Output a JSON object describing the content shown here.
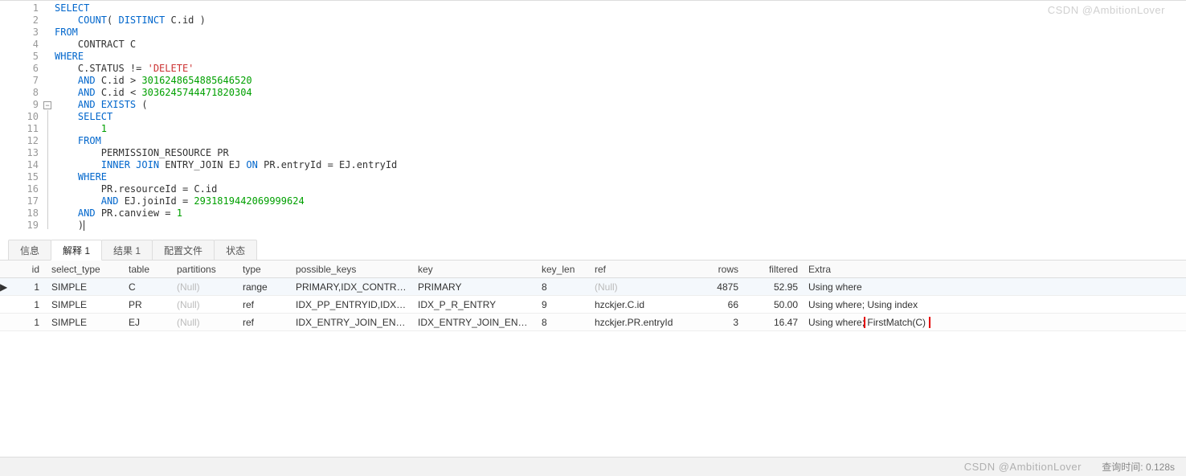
{
  "sql": {
    "lines": [
      {
        "n": 1,
        "tokens": [
          {
            "t": "SELECT",
            "c": "kw"
          }
        ]
      },
      {
        "n": 2,
        "tokens": [
          {
            "t": "    ",
            "c": ""
          },
          {
            "t": "COUNT",
            "c": "kw"
          },
          {
            "t": "( ",
            "c": ""
          },
          {
            "t": "DISTINCT",
            "c": "kw"
          },
          {
            "t": " C.id )",
            "c": ""
          }
        ]
      },
      {
        "n": 3,
        "tokens": [
          {
            "t": "FROM",
            "c": "kw"
          }
        ]
      },
      {
        "n": 4,
        "tokens": [
          {
            "t": "    CONTRACT C",
            "c": ""
          }
        ]
      },
      {
        "n": 5,
        "tokens": [
          {
            "t": "WHERE",
            "c": "kw"
          }
        ]
      },
      {
        "n": 6,
        "tokens": [
          {
            "t": "    C.STATUS != ",
            "c": ""
          },
          {
            "t": "'DELETE'",
            "c": "str"
          }
        ]
      },
      {
        "n": 7,
        "tokens": [
          {
            "t": "    ",
            "c": ""
          },
          {
            "t": "AND",
            "c": "kw"
          },
          {
            "t": " C.id > ",
            "c": ""
          },
          {
            "t": "3016248654885646520",
            "c": "num"
          }
        ]
      },
      {
        "n": 8,
        "tokens": [
          {
            "t": "    ",
            "c": ""
          },
          {
            "t": "AND",
            "c": "kw"
          },
          {
            "t": " C.id < ",
            "c": ""
          },
          {
            "t": "3036245744471820304",
            "c": "num"
          }
        ]
      },
      {
        "n": 9,
        "tokens": [
          {
            "t": "    ",
            "c": ""
          },
          {
            "t": "AND EXISTS",
            "c": "kw"
          },
          {
            "t": " (",
            "c": ""
          }
        ]
      },
      {
        "n": 10,
        "tokens": [
          {
            "t": "    ",
            "c": ""
          },
          {
            "t": "SELECT",
            "c": "kw"
          }
        ]
      },
      {
        "n": 11,
        "tokens": [
          {
            "t": "        ",
            "c": ""
          },
          {
            "t": "1",
            "c": "num"
          }
        ]
      },
      {
        "n": 12,
        "tokens": [
          {
            "t": "    ",
            "c": ""
          },
          {
            "t": "FROM",
            "c": "kw"
          }
        ]
      },
      {
        "n": 13,
        "tokens": [
          {
            "t": "        PERMISSION_RESOURCE PR",
            "c": ""
          }
        ]
      },
      {
        "n": 14,
        "tokens": [
          {
            "t": "        ",
            "c": ""
          },
          {
            "t": "INNER JOIN",
            "c": "kw"
          },
          {
            "t": " ENTRY_JOIN EJ ",
            "c": ""
          },
          {
            "t": "ON",
            "c": "kw"
          },
          {
            "t": " PR.entryId = EJ.entryId",
            "c": ""
          }
        ]
      },
      {
        "n": 15,
        "tokens": [
          {
            "t": "    ",
            "c": ""
          },
          {
            "t": "WHERE",
            "c": "kw"
          }
        ]
      },
      {
        "n": 16,
        "tokens": [
          {
            "t": "        PR.resourceId = C.id",
            "c": ""
          }
        ]
      },
      {
        "n": 17,
        "tokens": [
          {
            "t": "        ",
            "c": ""
          },
          {
            "t": "AND",
            "c": "kw"
          },
          {
            "t": " EJ.joinId = ",
            "c": ""
          },
          {
            "t": "2931819442069999624",
            "c": "num"
          }
        ]
      },
      {
        "n": 18,
        "tokens": [
          {
            "t": "    ",
            "c": ""
          },
          {
            "t": "AND",
            "c": "kw"
          },
          {
            "t": " PR.canview = ",
            "c": ""
          },
          {
            "t": "1",
            "c": "num"
          }
        ]
      },
      {
        "n": 19,
        "tokens": [
          {
            "t": "    )",
            "c": ""
          }
        ],
        "cursor": true
      }
    ]
  },
  "tabs": {
    "items": [
      {
        "label": "信息",
        "active": false
      },
      {
        "label": "解释 1",
        "active": true
      },
      {
        "label": "结果 1",
        "active": false
      },
      {
        "label": "配置文件",
        "active": false
      },
      {
        "label": "状态",
        "active": false
      }
    ]
  },
  "grid": {
    "columns": {
      "id": "id",
      "select_type": "select_type",
      "table": "table",
      "partitions": "partitions",
      "type": "type",
      "possible_keys": "possible_keys",
      "key": "key",
      "key_len": "key_len",
      "ref": "ref",
      "rows": "rows",
      "filtered": "filtered",
      "Extra": "Extra"
    },
    "null_text": "(Null)",
    "rows": [
      {
        "sel": true,
        "id": "1",
        "select_type": "SIMPLE",
        "table": "C",
        "partitions": "(Null)",
        "type": "range",
        "possible_keys": "PRIMARY,IDX_CONTRACT",
        "key": "PRIMARY",
        "key_len": "8",
        "ref": "(Null)",
        "rows": "4875",
        "filtered": "52.95",
        "Extra": "Using where"
      },
      {
        "sel": false,
        "id": "1",
        "select_type": "SIMPLE",
        "table": "PR",
        "partitions": "(Null)",
        "type": "ref",
        "possible_keys": "IDX_PP_ENTRYID,IDX_PP_N",
        "key": "IDX_P_R_ENTRY",
        "key_len": "9",
        "ref": "hzckjer.C.id",
        "rows": "66",
        "filtered": "50.00",
        "Extra": "Using where; Using index"
      },
      {
        "sel": false,
        "id": "1",
        "select_type": "SIMPLE",
        "table": "EJ",
        "partitions": "(Null)",
        "type": "ref",
        "possible_keys": "IDX_ENTRY_JOIN_ENTRYI",
        "key": "IDX_ENTRY_JOIN_ENTRYI",
        "key_len": "8",
        "ref": "hzckjer.PR.entryId",
        "rows": "3",
        "filtered": "16.47",
        "Extra": "Using where; FirstMatch(C)",
        "highlight": "FirstMatch(C)"
      }
    ]
  },
  "statusbar": {
    "text": "查询时间: 0.128s"
  },
  "watermark": "CSDN @AmbitionLover"
}
